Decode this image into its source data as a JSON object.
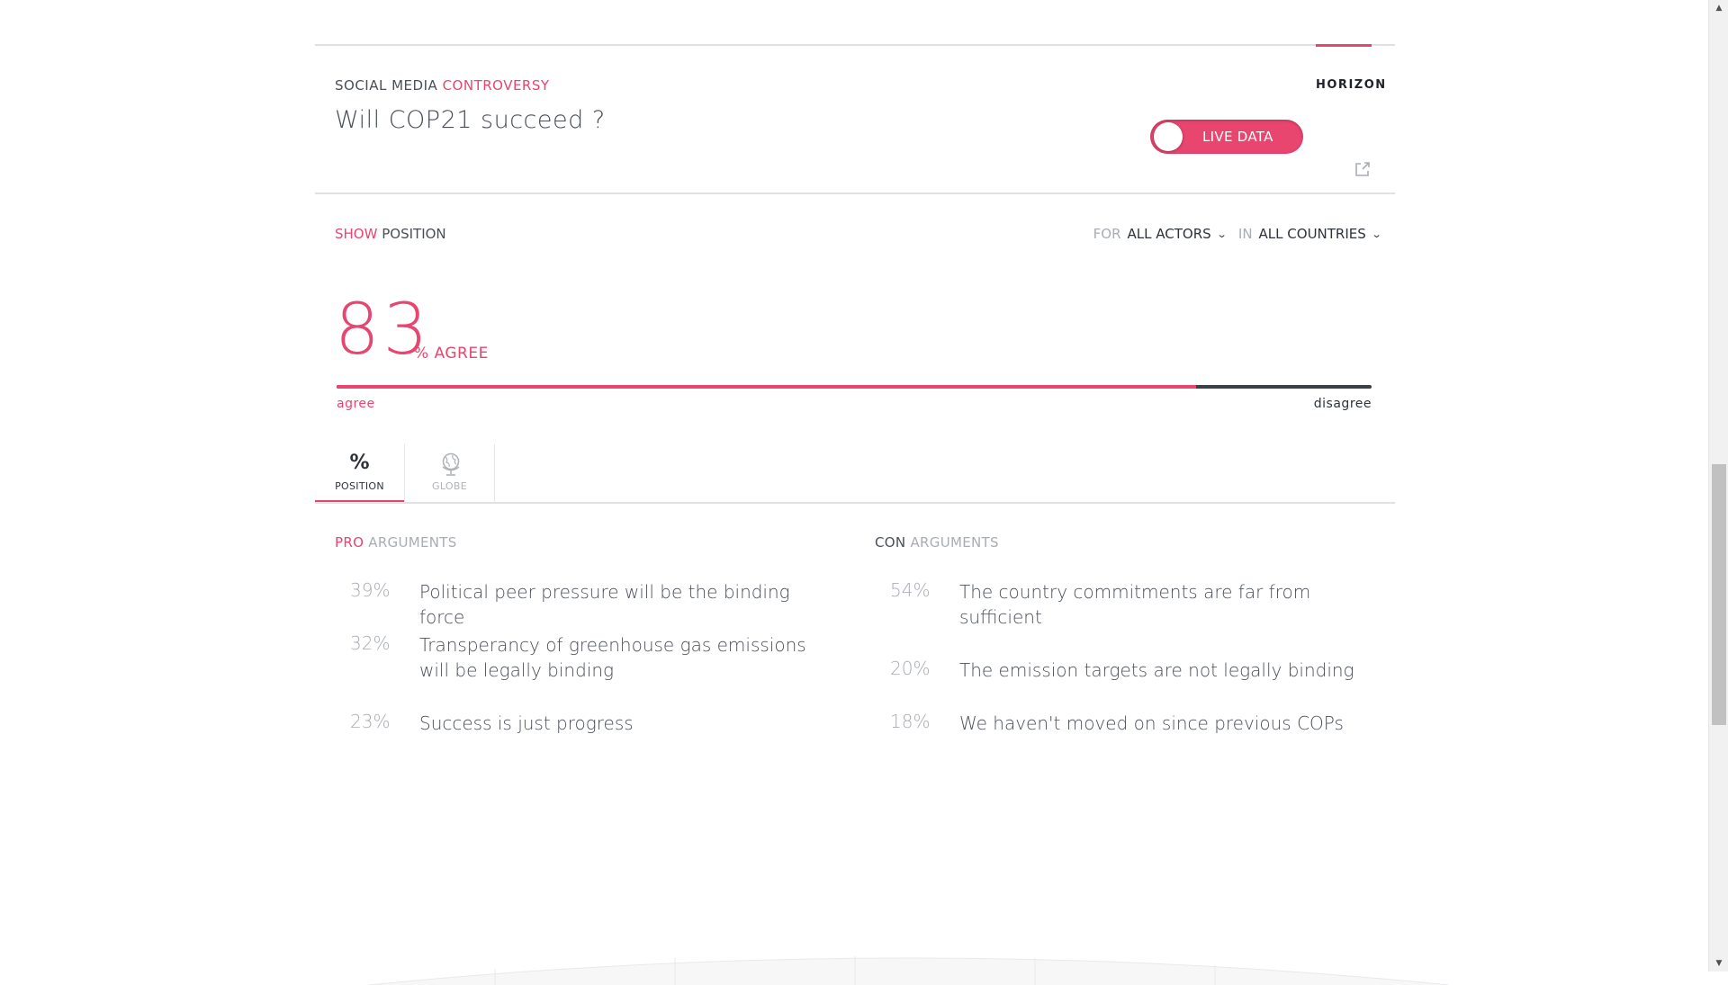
{
  "header": {
    "kicker_prefix": "SOCIAL MEDIA",
    "kicker_highlight": "CONTROVERSY",
    "title": "Will COP21 succeed ?",
    "brand": "HORIZON",
    "live_toggle_label": "LIVE DATA",
    "live_toggle_on": true
  },
  "controls": {
    "show_prefix": "SHOW",
    "show_value": "POSITION",
    "actors_prefix": "FOR",
    "actors_value": "ALL ACTORS",
    "countries_prefix": "IN",
    "countries_value": "ALL COUNTRIES"
  },
  "position": {
    "value": "83",
    "value_label": "% AGREE",
    "agree_fraction": 0.83,
    "left_label": "agree",
    "right_label": "disagree"
  },
  "tabs": [
    {
      "label": "POSITION",
      "icon": "percent-icon",
      "glyph": "%",
      "active": true
    },
    {
      "label": "GLOBE",
      "icon": "globe-icon",
      "glyph": "",
      "active": false
    }
  ],
  "pro": {
    "head_highlight": "PRO",
    "head_rest": "ARGUMENTS",
    "items": [
      {
        "pct": "39%",
        "text": "Political peer pressure will be the binding force"
      },
      {
        "pct": "32%",
        "text": "Transperancy of greenhouse gas emissions will be legally binding"
      },
      {
        "pct": "23%",
        "text": "Success is just progress"
      }
    ]
  },
  "con": {
    "head_highlight": "CON",
    "head_rest": "ARGUMENTS",
    "items": [
      {
        "pct": "54%",
        "text": "The country commitments are far from sufficient"
      },
      {
        "pct": "20%",
        "text": "The emission targets are not legally binding"
      },
      {
        "pct": "18%",
        "text": "We haven't moved on since previous COPs"
      }
    ]
  },
  "colors": {
    "accent": "#e8456f",
    "dark": "#3b3f46",
    "muted": "#a9adb3"
  }
}
